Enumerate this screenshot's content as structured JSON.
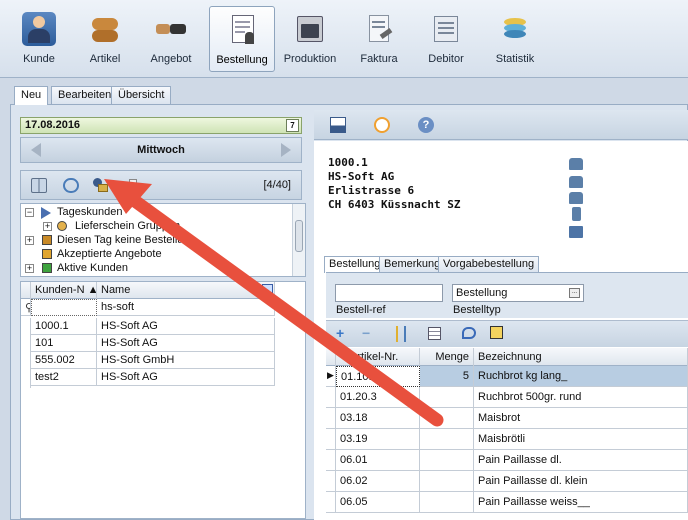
{
  "ribbon": {
    "items": [
      {
        "label": "Kunde",
        "icon": "customer-icon"
      },
      {
        "label": "Artikel",
        "icon": "bread-icon"
      },
      {
        "label": "Angebot",
        "icon": "handshake-icon"
      },
      {
        "label": "Bestellung",
        "icon": "order-document-icon",
        "active": true
      },
      {
        "label": "Produktion",
        "icon": "oven-icon"
      },
      {
        "label": "Faktura",
        "icon": "invoice-icon"
      },
      {
        "label": "Debitor",
        "icon": "debitor-icon"
      },
      {
        "label": "Statistik",
        "icon": "statistics-icon"
      }
    ]
  },
  "tabs": [
    "Neu",
    "Bearbeiten",
    "Übersicht"
  ],
  "date": {
    "value": "17.08.2016",
    "weekday": "Mittwoch",
    "calendar_glyph": "7"
  },
  "left_toolbar": {
    "counter": "[4/40]"
  },
  "tree": {
    "items": [
      {
        "label": "Tageskunden"
      },
      {
        "label": "Lieferschein Gruppen"
      },
      {
        "label": "Diesen Tag keine Bestellung"
      },
      {
        "label": "Akzeptierte Angebote"
      },
      {
        "label": "Aktive Kunden"
      }
    ],
    "expand_plus": "+",
    "expand_minus": "−"
  },
  "customer_grid": {
    "headers": [
      "Kunden-N ▲",
      "Name"
    ],
    "filter_value": "hs-soft",
    "rows": [
      [
        "1000.1",
        "HS-Soft AG"
      ],
      [
        "101",
        "HS-Soft AG"
      ],
      [
        "555.002",
        "HS-Soft GmbH"
      ],
      [
        "test2",
        "HS-Soft AG"
      ]
    ]
  },
  "address": {
    "lines": [
      "1000.1",
      "HS-Soft AG",
      "Erlistrasse 6",
      "CH 6403 Küssnacht SZ"
    ]
  },
  "subtabs": [
    "Bestellung",
    "Bemerkung",
    "Vorgabebestellung"
  ],
  "form": {
    "bestell_ref_value": "",
    "bestell_ref_label": "Bestell-ref",
    "bestelltyp_value": "Bestellung",
    "bestelltyp_label": "Bestelltyp",
    "dropdown_glyph": "..."
  },
  "order_grid": {
    "headers": [
      "Artikel-Nr.",
      "Menge",
      "Bezeichnung"
    ],
    "rows": [
      {
        "artikel": "01.10.3",
        "menge": "5",
        "bezeichnung": "Ruchbrot kg lang_",
        "selected": true
      },
      {
        "artikel": "01.20.3",
        "menge": "",
        "bezeichnung": "Ruchbrot 500gr. rund"
      },
      {
        "artikel": "03.18",
        "menge": "",
        "bezeichnung": "Maisbrot"
      },
      {
        "artikel": "03.19",
        "menge": "",
        "bezeichnung": "Maisbrötli"
      },
      {
        "artikel": "06.01",
        "menge": "",
        "bezeichnung": "Pain Paillasse dl."
      },
      {
        "artikel": "06.02",
        "menge": "",
        "bezeichnung": "Pain Paillasse dl. klein"
      },
      {
        "artikel": "06.05",
        "menge": "",
        "bezeichnung": "Pain Paillasse weiss__"
      }
    ]
  },
  "colors": {
    "arrow": "#e8503d",
    "selected_row": "#b8cde2",
    "date_bar": "#cfe3b5"
  }
}
